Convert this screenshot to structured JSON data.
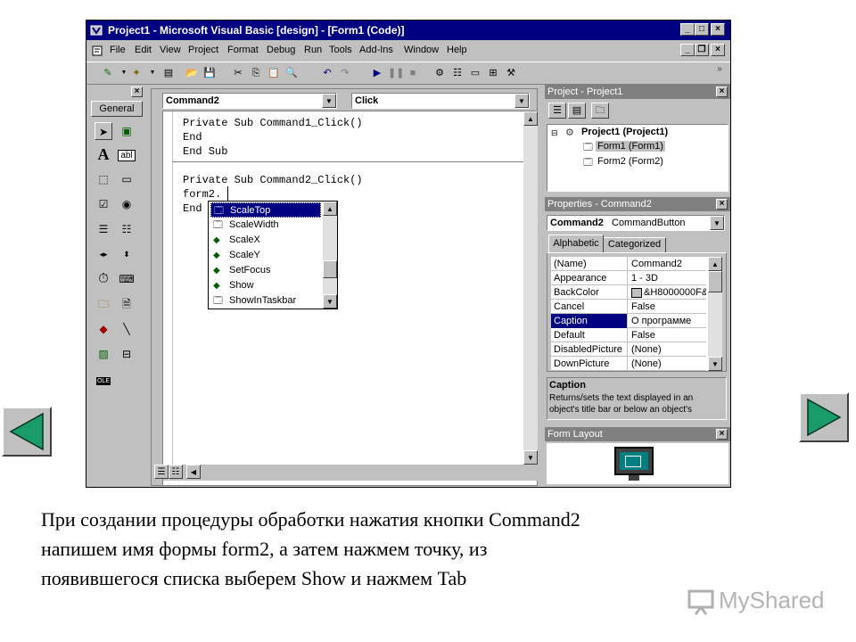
{
  "window": {
    "title": "Project1 - Microsoft Visual Basic [design] - [Form1 (Code)]"
  },
  "menu": [
    "File",
    "Edit",
    "View",
    "Project",
    "Format",
    "Debug",
    "Run",
    "Tools",
    "Add-Ins",
    "Window",
    "Help"
  ],
  "toolbox": {
    "tab_label": "General",
    "ole_label": "OLE"
  },
  "code_window": {
    "object_combo": "Command2",
    "procedure_combo": "Click",
    "lines": [
      "Private Sub Command1_Click()",
      "End",
      "End Sub",
      "Private Sub Command2_Click()",
      "form2.",
      "End"
    ],
    "autocomplete": {
      "items": [
        "ScaleTop",
        "ScaleWidth",
        "ScaleX",
        "ScaleY",
        "SetFocus",
        "Show",
        "ShowInTaskbar"
      ],
      "selected_index": 0
    }
  },
  "project_panel": {
    "title": "Project - Project1",
    "root": "Project1 (Project1)",
    "children": [
      "Form1 (Form1)",
      "Form2 (Form2)"
    ]
  },
  "properties_panel": {
    "title": "Properties - Command2",
    "object_name": "Command2",
    "object_type": "CommandButton",
    "tabs": [
      "Alphabetic",
      "Categorized"
    ],
    "rows": [
      {
        "name": "(Name)",
        "value": "Command2"
      },
      {
        "name": "Appearance",
        "value": "1 - 3D"
      },
      {
        "name": "BackColor",
        "value": "&H8000000F&"
      },
      {
        "name": "Cancel",
        "value": "False"
      },
      {
        "name": "Caption",
        "value": "О программе"
      },
      {
        "name": "Default",
        "value": "False"
      },
      {
        "name": "DisabledPicture",
        "value": "(None)"
      },
      {
        "name": "DownPicture",
        "value": "(None)"
      }
    ],
    "selected_row": 4,
    "description_title": "Caption",
    "description_lines": [
      "Returns/sets the text displayed in an",
      "object's title bar or below an object's"
    ]
  },
  "form_layout_panel": {
    "title": "Form Layout"
  },
  "caption": {
    "lines": [
      "При создании процедуры обработки нажатия кнопки Command2",
      "напишем имя формы form2, а  затем нажмем точку, из",
      "появившегося списка выберем Show и нажмем Tab"
    ]
  },
  "watermark": {
    "text": "MyShared"
  },
  "colors": {
    "titlebar": "#000080",
    "panel_title_inactive": "#808080",
    "selection": "#000080",
    "nav_arrow": "#1a9c6a"
  }
}
